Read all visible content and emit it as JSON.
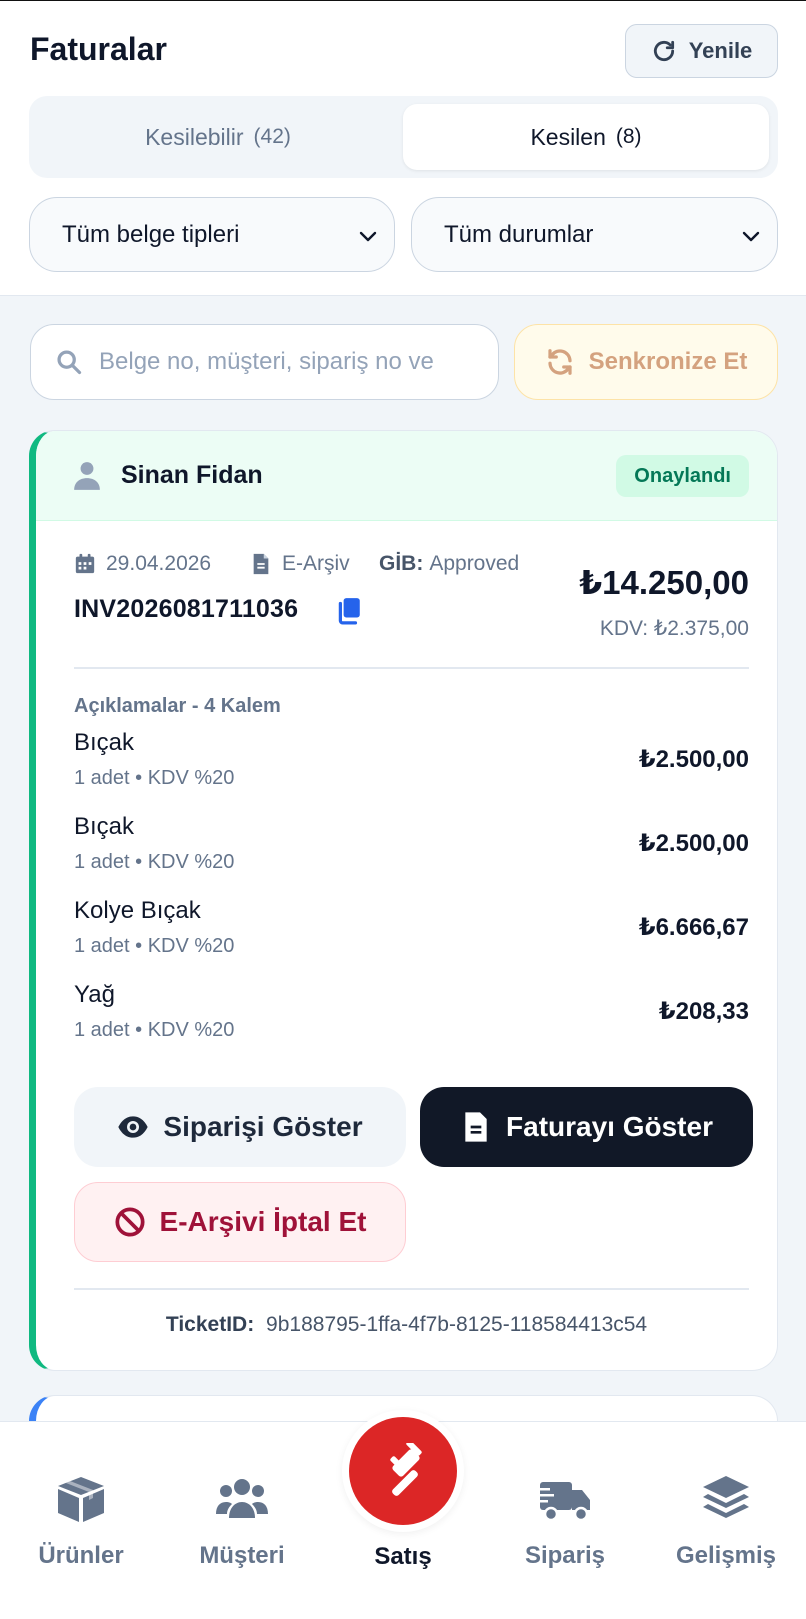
{
  "header": {
    "title": "Faturalar",
    "refresh_label": "Yenile"
  },
  "tabs": [
    {
      "label": "Kesilebilir",
      "count": "(42)",
      "active": false
    },
    {
      "label": "Kesilen",
      "count": "(8)",
      "active": true
    }
  ],
  "filters": {
    "doc_type": "Tüm belge tipleri",
    "status": "Tüm durumlar"
  },
  "search": {
    "placeholder": "Belge no, müşteri, sipariş no ve",
    "value": ""
  },
  "sync_label": "Senkronize Et",
  "invoice": {
    "customer": "Sinan Fidan",
    "status": "Onaylandı",
    "date": "29.04.2026",
    "doc_type": "E-Arşiv",
    "gib_label": "GİB:",
    "gib_status": "Approved",
    "number": "INV2026081711036",
    "total": "₺14.250,00",
    "kdv": "KDV: ₺2.375,00",
    "items_header": "Açıklamalar - 4 Kalem",
    "items": [
      {
        "name": "Bıçak",
        "sub": "1 adet • KDV %20",
        "price": "₺2.500,00"
      },
      {
        "name": "Bıçak",
        "sub": "1 adet • KDV %20",
        "price": "₺2.500,00"
      },
      {
        "name": "Kolye Bıçak",
        "sub": "1 adet • KDV %20",
        "price": "₺6.666,67"
      },
      {
        "name": "Yağ",
        "sub": "1 adet • KDV %20",
        "price": "₺208,33"
      }
    ],
    "show_order_label": "Siparişi Göster",
    "show_invoice_label": "Faturayı Göster",
    "cancel_label": "E-Arşivi İptal Et",
    "ticket_label": "TicketID:",
    "ticket_id": "9b188795-1ffa-4f7b-8125-118584413c54"
  },
  "nav": [
    {
      "label": "Ürünler",
      "icon": "box-icon"
    },
    {
      "label": "Müşteri",
      "icon": "users-icon"
    },
    {
      "label": "Satış",
      "icon": "gavel-icon",
      "active": true
    },
    {
      "label": "Sipariş",
      "icon": "truck-icon"
    },
    {
      "label": "Gelişmiş",
      "icon": "layers-icon"
    }
  ],
  "colors": {
    "accent_green": "#10b981",
    "fab_red": "#dc2626",
    "dark_button": "#111827",
    "sync_amber": "#d4a27f"
  }
}
